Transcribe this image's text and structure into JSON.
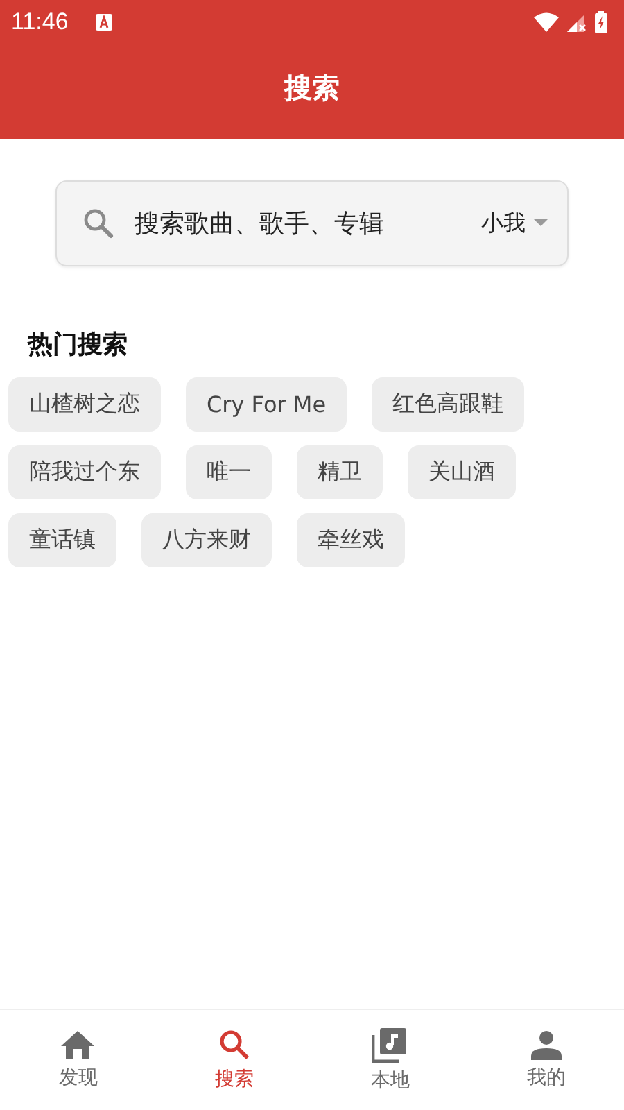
{
  "status_bar": {
    "time": "11:46"
  },
  "header": {
    "title": "搜索"
  },
  "search": {
    "placeholder": "搜索歌曲、歌手、专辑",
    "source": "小我"
  },
  "hot": {
    "title": "热门搜索",
    "tags": [
      "山楂树之恋",
      "Cry For Me",
      "红色高跟鞋",
      "陪我过个东",
      "唯一",
      "精卫",
      "关山酒",
      "童话镇",
      "八方来财",
      "牵丝戏"
    ]
  },
  "nav": [
    {
      "kind": "home",
      "label": "发现",
      "selected": false
    },
    {
      "kind": "search",
      "label": "搜索",
      "selected": true
    },
    {
      "kind": "library",
      "label": "本地",
      "selected": false
    },
    {
      "kind": "person",
      "label": "我的",
      "selected": false
    }
  ]
}
